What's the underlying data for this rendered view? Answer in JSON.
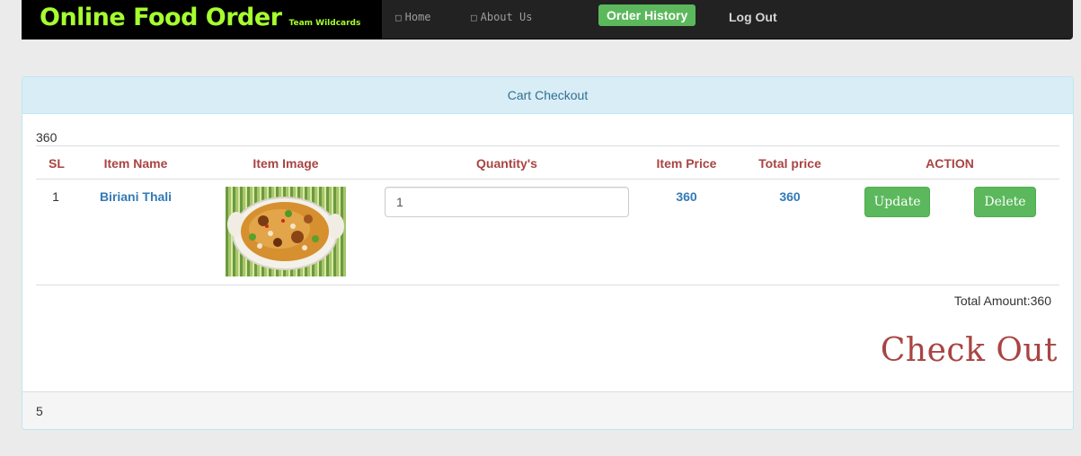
{
  "navbar": {
    "brand_title": "Online Food Order",
    "brand_sub": "Team Wildcards",
    "home_label": "Home",
    "about_label": "About Us",
    "history_label": "Order History",
    "logout_label": "Log Out",
    "home_icon": "home-icon",
    "about_icon": "info-icon"
  },
  "panel": {
    "heading": "Cart Checkout",
    "top_value": "360",
    "footer_value": "5"
  },
  "table": {
    "headers": [
      "SL",
      "Item Name",
      "Item Image",
      "Quantity's",
      "Item Price",
      "Total price",
      "ACTION"
    ],
    "rows": [
      {
        "sl": "1",
        "item_name": "Biriani Thali",
        "quantity": "1",
        "item_price": "360",
        "total_price": "360",
        "update_label": "Update",
        "delete_label": "Delete"
      }
    ]
  },
  "summary": {
    "total_text": "Total Amount:360",
    "checkout_label": "Check Out"
  },
  "colors": {
    "brand": "#a6ff2e",
    "success": "#5cb85c",
    "header_text": "#a94442",
    "link": "#337ab7",
    "panel_heading_bg": "#d9edf7"
  }
}
